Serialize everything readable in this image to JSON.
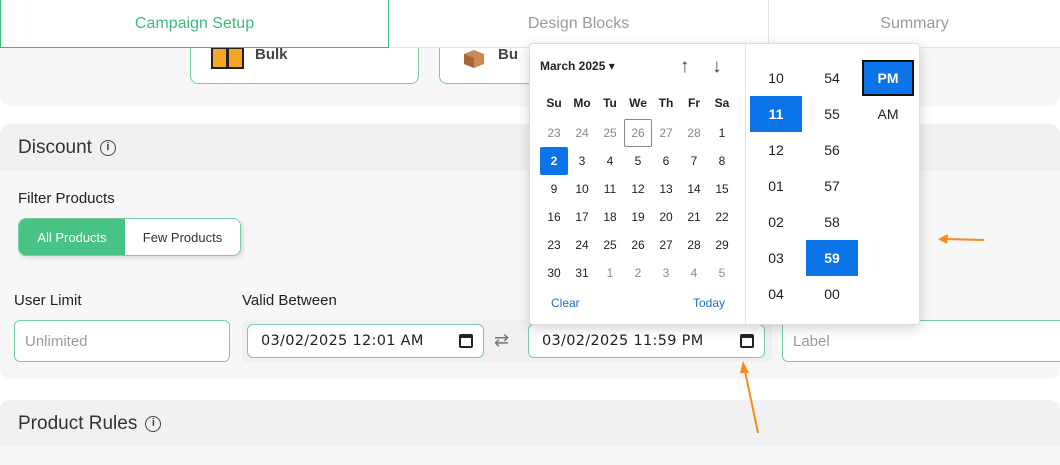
{
  "tabs": [
    {
      "label": "Campaign Setup"
    },
    {
      "label": "Design Blocks"
    },
    {
      "label": "Summary"
    }
  ],
  "product_types": {
    "bulk_label": "Bulk",
    "box_label": "Bu"
  },
  "discount": {
    "title": "Discount",
    "filter_label": "Filter Products",
    "filter_options": [
      "All Products",
      "Few Products"
    ],
    "user_limit_label": "User Limit",
    "user_limit_placeholder": "Unlimited",
    "valid_between_label": "Valid Between",
    "start_value": "03/02/2025 12:01 AM",
    "end_value": "03/02/2025 11:59 PM",
    "label_placeholder": "Label"
  },
  "product_rules": {
    "title": "Product Rules"
  },
  "picker": {
    "month": "March 2025",
    "weekdays": [
      "Su",
      "Mo",
      "Tu",
      "We",
      "Th",
      "Fr",
      "Sa"
    ],
    "days": [
      [
        "23",
        "24",
        "25",
        "26",
        "27",
        "28",
        "1"
      ],
      [
        "2",
        "3",
        "4",
        "5",
        "6",
        "7",
        "8"
      ],
      [
        "9",
        "10",
        "11",
        "12",
        "13",
        "14",
        "15"
      ],
      [
        "16",
        "17",
        "18",
        "19",
        "20",
        "21",
        "22"
      ],
      [
        "23",
        "24",
        "25",
        "26",
        "27",
        "28",
        "29"
      ],
      [
        "30",
        "31",
        "1",
        "2",
        "3",
        "4",
        "5"
      ]
    ],
    "clear_label": "Clear",
    "today_label": "Today",
    "hours": [
      "10",
      "11",
      "12",
      "01",
      "02",
      "03",
      "04"
    ],
    "minutes": [
      "54",
      "55",
      "56",
      "57",
      "58",
      "59",
      "00"
    ],
    "ampm": [
      "PM",
      "AM"
    ],
    "selected_day": "2",
    "selected_hour": "11",
    "selected_minute": "59",
    "selected_ampm": "PM"
  },
  "colors": {
    "accent_green": "#47c485",
    "selection_blue": "#0a74e8",
    "annotation_orange": "#f28c1c"
  }
}
